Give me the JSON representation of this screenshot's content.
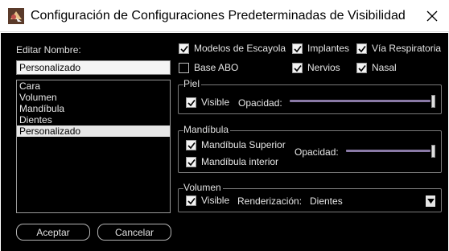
{
  "window": {
    "title": "Configuración de Configuraciones Predeterminadas de Visibilidad"
  },
  "left": {
    "edit_label": "Editar Nombre:",
    "name_value": "Personalizado",
    "list": [
      "Cara",
      "Volumen",
      "Mandíbula",
      "Dientes",
      "Personalizado"
    ],
    "selected_index": 4,
    "accept_label": "Aceptar",
    "cancel_label": "Cancelar"
  },
  "options": [
    {
      "label": "Modelos de Escayola",
      "checked": true
    },
    {
      "label": "Implantes",
      "checked": true
    },
    {
      "label": "Vía Respiratoria",
      "checked": true
    },
    {
      "label": "Base ABO",
      "checked": false
    },
    {
      "label": "Nervios",
      "checked": true
    },
    {
      "label": "Nasal",
      "checked": true
    }
  ],
  "piel": {
    "title": "Piel",
    "visible_label": "Visible",
    "visible_checked": true,
    "opacity_label": "Opacidad:",
    "opacity": 1.0
  },
  "mandibula": {
    "title": "Mandíbula",
    "superior_label": "Mandíbula Superior",
    "superior_checked": true,
    "inferior_label": "Mandíbula interior",
    "inferior_checked": true,
    "opacity_label": "Opacidad:",
    "opacity": 1.0
  },
  "volumen": {
    "title": "Volumen",
    "visible_label": "Visible",
    "visible_checked": true,
    "render_label": "Renderización:",
    "render_value": "Dientes"
  },
  "icons": {
    "app": "app-logo-icon",
    "close": "close-icon",
    "check": "checkmark-icon",
    "dropdown": "dropdown-arrow-icon"
  },
  "colors": {
    "dialog_bg": "#000000",
    "selection_bg": "#e6e6e6",
    "slider_track": "#8a7aa6"
  }
}
